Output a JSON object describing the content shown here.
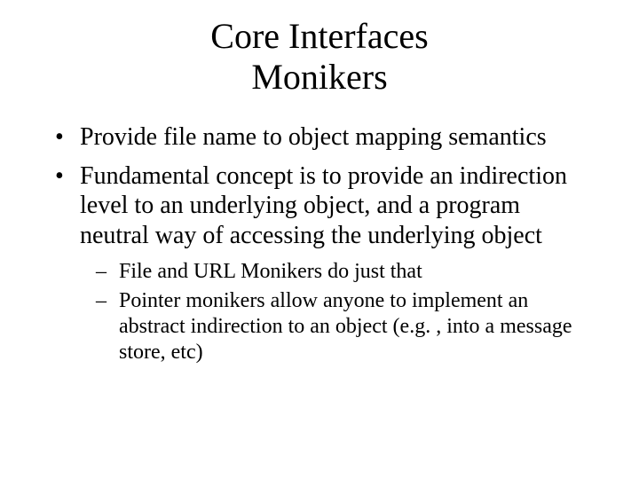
{
  "title_line1": "Core Interfaces",
  "title_line2": "Monikers",
  "bullets": [
    "Provide file name to object mapping semantics",
    "Fundamental concept is to provide an indirection level to an underlying object, and a program neutral way of accessing the underlying object"
  ],
  "sub_bullets": [
    "File and URL Monikers do just that",
    "Pointer monikers allow anyone to implement an abstract indirection to an object (e.g. , into a message store, etc)"
  ]
}
